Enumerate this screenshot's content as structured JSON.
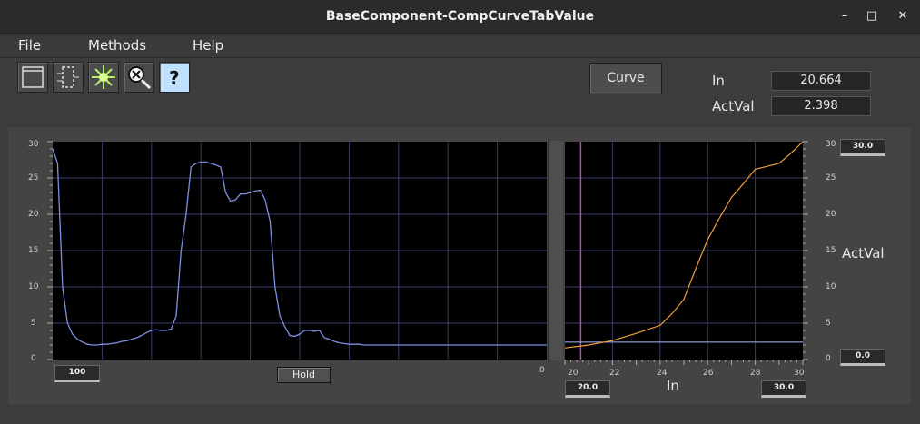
{
  "window": {
    "title": "BaseComponent-CompCurveTabValue",
    "minimize": "–",
    "maximize": "□",
    "close": "✕"
  },
  "menu": [
    "File",
    "Methods",
    "Help"
  ],
  "toolbar": {
    "icons": [
      "window-icon",
      "component-icon",
      "burst-icon",
      "zoom-reset-icon",
      "help-icon"
    ],
    "help_glyph": "?",
    "curve_label": "Curve"
  },
  "readouts": {
    "in_label": "In",
    "in_value": "20.664",
    "actval_label": "ActVal",
    "actval_value": "2.398"
  },
  "history_plot": {
    "y_ticks": [
      "30",
      "25",
      "20",
      "15",
      "10",
      "5",
      "0"
    ],
    "ylim": [
      0,
      30
    ],
    "time_window": "100",
    "right_label": "0",
    "hold_label": "Hold",
    "line_color": "#7f8fe0"
  },
  "curve_plot": {
    "x_ticks": [
      "20",
      "22",
      "24",
      "26",
      "28",
      "30"
    ],
    "y_ticks": [
      "30",
      "25",
      "20",
      "15",
      "10",
      "5",
      "0"
    ],
    "x_min_box": "20.0",
    "x_max_box": "30.0",
    "y_max_box": "30.0",
    "y_min_box": "0.0",
    "xlabel": "In",
    "ylabel": "ActVal",
    "cursor_in": 20.664,
    "curve_color": "#f0a040",
    "cursor_color": "#c040c0"
  },
  "chart_data": [
    {
      "type": "line",
      "ylim": [
        0,
        30
      ],
      "series": [
        {
          "x": [
            0,
            1,
            2,
            3,
            4,
            5,
            6,
            7,
            8,
            9,
            10,
            11,
            12,
            13,
            14,
            15,
            16,
            17,
            18,
            19,
            20,
            21,
            22,
            23,
            24,
            25,
            26,
            27,
            28,
            29,
            30,
            31,
            32,
            33,
            34,
            35,
            36,
            37,
            38,
            39,
            40,
            41,
            42,
            43,
            44,
            45,
            46,
            47,
            48,
            49,
            50,
            51,
            52,
            53,
            54,
            55,
            56,
            57,
            58,
            59,
            60,
            61,
            62,
            63,
            64,
            65,
            66,
            67,
            68,
            69,
            70,
            71,
            72,
            73,
            74,
            75,
            76,
            77,
            78,
            79,
            80,
            81,
            82,
            83,
            84,
            85,
            86,
            87,
            88,
            89,
            90,
            91,
            92,
            93,
            94,
            95,
            96,
            97,
            98,
            99,
            100
          ],
          "values": [
            29,
            27,
            10,
            5,
            3.5,
            2.8,
            2.4,
            2.1,
            2.0,
            2.0,
            2.1,
            2.1,
            2.2,
            2.3,
            2.5,
            2.6,
            2.8,
            3.0,
            3.3,
            3.7,
            4.0,
            4.1,
            4.0,
            4.0,
            4.2,
            6,
            15,
            20,
            26.5,
            27,
            27.2,
            27.2,
            27,
            26.8,
            26.5,
            23,
            21.8,
            22,
            22.8,
            22.8,
            23,
            23.2,
            23.3,
            22,
            19,
            10,
            6,
            4.5,
            3.3,
            3.2,
            3.5,
            4.0,
            4.0,
            3.9,
            4.0,
            3.0,
            2.8,
            2.5,
            2.3,
            2.2,
            2.1,
            2.1,
            2.1,
            2.0,
            2.0,
            2.0,
            2.0,
            2.0,
            2.0,
            2.0,
            2.0,
            2.0,
            2.0,
            2.0,
            2.0,
            2.0,
            2.0,
            2.0,
            2.0,
            2.0,
            2.0,
            2.0,
            2.0,
            2.0,
            2.0,
            2.0,
            2.0,
            2.0,
            2.0,
            2.0,
            2.0,
            2.0,
            2.0,
            2.0,
            2.0,
            2.0,
            2.0,
            2.0,
            2.0,
            2.0,
            2.0
          ]
        }
      ]
    },
    {
      "type": "line",
      "xlabel": "In",
      "ylabel": "ActVal",
      "xlim": [
        20,
        30
      ],
      "ylim": [
        0,
        30
      ],
      "series": [
        {
          "x": [
            20,
            21,
            22,
            23,
            24,
            24.5,
            25,
            25.5,
            26,
            26.5,
            27,
            27.5,
            28,
            28.5,
            29,
            29.5,
            30
          ],
          "values": [
            1.6,
            2.0,
            2.6,
            3.6,
            4.7,
            6.3,
            8.3,
            12.5,
            16.5,
            19.5,
            22.3,
            24.2,
            26.2,
            26.6,
            27.0,
            28.4,
            30.0
          ]
        }
      ]
    }
  ]
}
